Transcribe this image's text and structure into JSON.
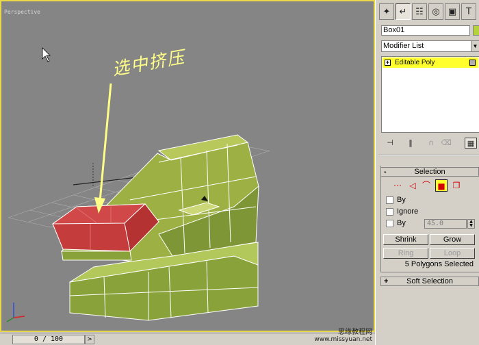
{
  "viewport": {
    "label": "Perspective",
    "annotation": "选中挤压"
  },
  "timeline": {
    "frame_display": "0 / 100",
    "next_label": ">"
  },
  "watermark": {
    "line1": "思缘教程网",
    "line2": "www.missyuan.net"
  },
  "command_panel": {
    "tabs": [
      "create-icon",
      "modify-icon",
      "hierarchy-icon",
      "motion-icon",
      "display-icon",
      "utilities-icon"
    ],
    "object_name": "Box01",
    "object_color": "#b4d23c",
    "modifier_list": "Modifier List",
    "stack": {
      "item": "Editable Poly",
      "expand": "+"
    },
    "selection": {
      "title": "Selection",
      "sign": "-",
      "by_vertex": "By",
      "ignore_backfacing": "Ignore",
      "by_angle": "By",
      "angle_value": "45.0",
      "shrink": "Shrink",
      "grow": "Grow",
      "ring": "Ring",
      "loop": "Loop",
      "status": "5 Polygons Selected"
    },
    "soft_selection": {
      "title": "Soft Selection",
      "sign": "+"
    },
    "accent_color": "#ffff2e",
    "subobject_color": "#d20000"
  }
}
